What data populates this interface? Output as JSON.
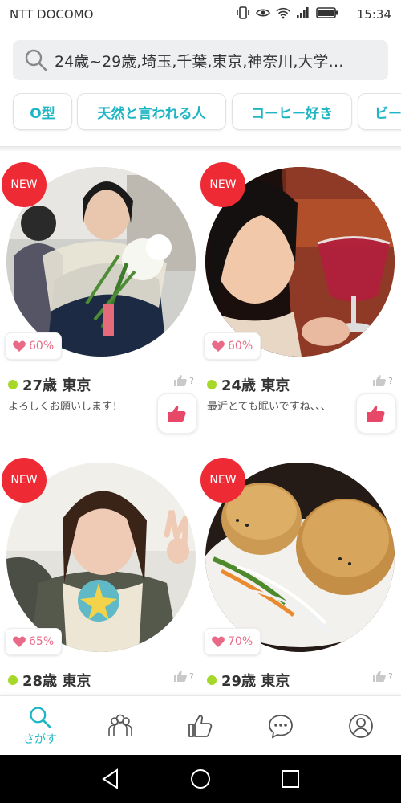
{
  "status_bar": {
    "carrier": "NTT DOCOMO",
    "time": "15:34"
  },
  "search": {
    "query": "24歳~29歳,埼玉,千葉,東京,神奈川,大学…"
  },
  "chips": [
    {
      "label": "O型"
    },
    {
      "label": "天然と言われる人"
    },
    {
      "label": "コーヒー好き"
    },
    {
      "label": "ビー"
    }
  ],
  "cards": [
    {
      "badge": "NEW",
      "match": "60%",
      "age_location": "27歳 東京",
      "message": "よろしくお願いします！",
      "thumb_q": "?",
      "photo": "woman-with-flowers"
    },
    {
      "badge": "NEW",
      "match": "60%",
      "age_location": "24歳 東京",
      "message": "最近とても眠いですね、、、",
      "thumb_q": "?",
      "photo": "woman-with-wine"
    },
    {
      "badge": "NEW",
      "match": "65%",
      "age_location": "28歳 東京",
      "message": "",
      "thumb_q": "?",
      "photo": "woman-peace-sign"
    },
    {
      "badge": "NEW",
      "match": "70%",
      "age_location": "29歳 東京",
      "message": "",
      "thumb_q": "?",
      "photo": "steamed-buns"
    }
  ],
  "bottom_nav": {
    "search_label": "さがす"
  },
  "colors": {
    "accent": "#1fb6c3",
    "new_badge": "#ee2a35",
    "match_text": "#e86a86",
    "online_dot": "#a6d82a"
  },
  "icons": [
    "search-icon",
    "vibrate-icon",
    "eye-icon",
    "wifi-icon",
    "signal-icon",
    "battery-icon",
    "heart-icon",
    "thumbs-up-icon",
    "community-icon",
    "chat-icon",
    "profile-icon",
    "back-icon",
    "home-icon",
    "recents-icon"
  ]
}
